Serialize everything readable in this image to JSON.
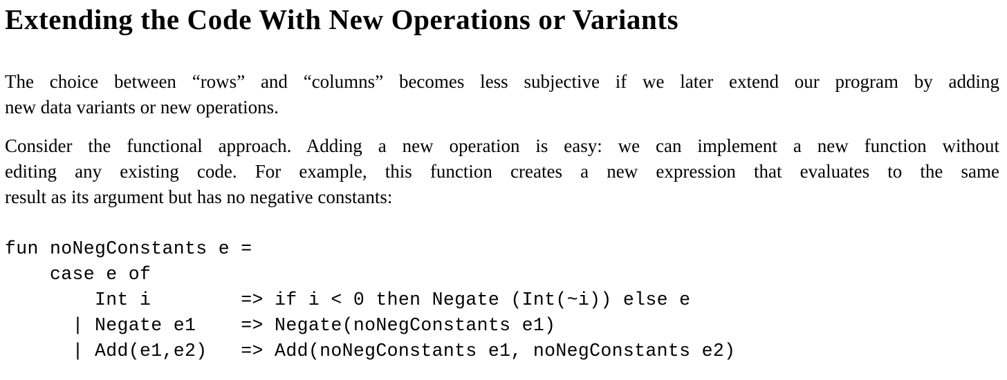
{
  "document": {
    "heading": "Extending the Code With New Operations or Variants",
    "paragraphs": [
      {
        "lines": [
          "The choice between “rows” and “columns” becomes less subjective if we later extend our program by adding",
          "new data variants or new operations."
        ]
      },
      {
        "lines": [
          "Consider the functional approach.  Adding a new operation is easy:  we can implement a new function without",
          "editing any existing code.  For example, this function creates a new expression that evaluates to the same",
          "result as its argument but has no negative constants:"
        ]
      }
    ],
    "code_block": {
      "lines": [
        "fun noNegConstants e =",
        "    case e of",
        "        Int i        => if i < 0 then Negate (Int(~i)) else e",
        "      | Negate e1    => Negate(noNegConstants e1)",
        "      | Add(e1,e2)   => Add(noNegConstants e1, noNegConstants e2)"
      ]
    }
  }
}
